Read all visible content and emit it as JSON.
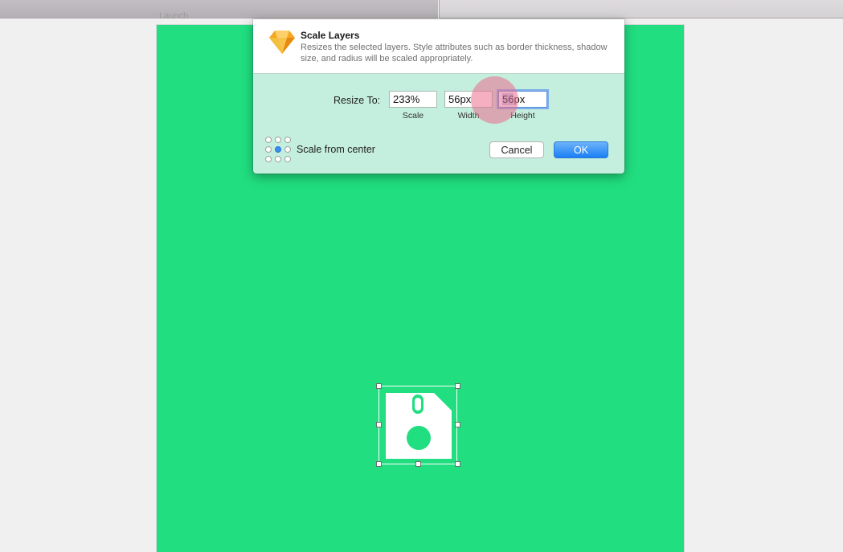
{
  "canvas": {
    "artboard_label": "Launch",
    "artboard_color": "#21de80"
  },
  "dialog": {
    "title": "Scale Layers",
    "description": "Resizes the selected layers. Style attributes such as border thickness, shadow size, and radius will be scaled appropriately.",
    "resize_label": "Resize To:",
    "fields": {
      "scale": {
        "value": "233%",
        "label": "Scale"
      },
      "width": {
        "value": "56px",
        "label": "Width"
      },
      "height": {
        "value_selected": "56",
        "value_rest": "px",
        "label": "Height"
      }
    },
    "scale_from_center_label": "Scale from center",
    "anchor_selected": "center",
    "cancel_label": "Cancel",
    "ok_label": "OK",
    "accent_color": "#1b7ff5"
  },
  "selection": {
    "icon": "floppy-disk-icon"
  }
}
